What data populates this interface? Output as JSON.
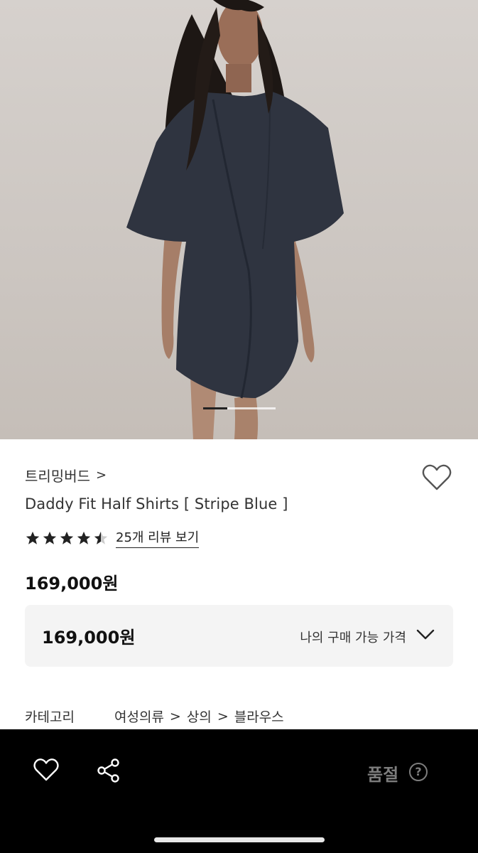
{
  "hero": {
    "image": "model-wearing-navy-half-shirt-dress",
    "carousel": {
      "total": 3,
      "active": 1
    }
  },
  "product": {
    "brand": "트리밍버드",
    "brand_chevron": ">",
    "title": "Daddy Fit Half Shirts [ Stripe Blue ]",
    "rating": 4.5,
    "review_link": "25개 리뷰 보기",
    "price": "169,000원"
  },
  "price_box": {
    "price": "169,000원",
    "label": "나의 구매 가능 가격"
  },
  "category": {
    "label": "카테고리",
    "path": [
      "여성의류",
      "상의",
      "블라우스"
    ],
    "separator": ">"
  },
  "bottom_bar": {
    "status": "품절",
    "help": "?"
  },
  "colors": {
    "bottom_bar_bg": "#000000",
    "soldout_text": "#7d7d7d",
    "price_box_bg": "#f4f4f4"
  }
}
